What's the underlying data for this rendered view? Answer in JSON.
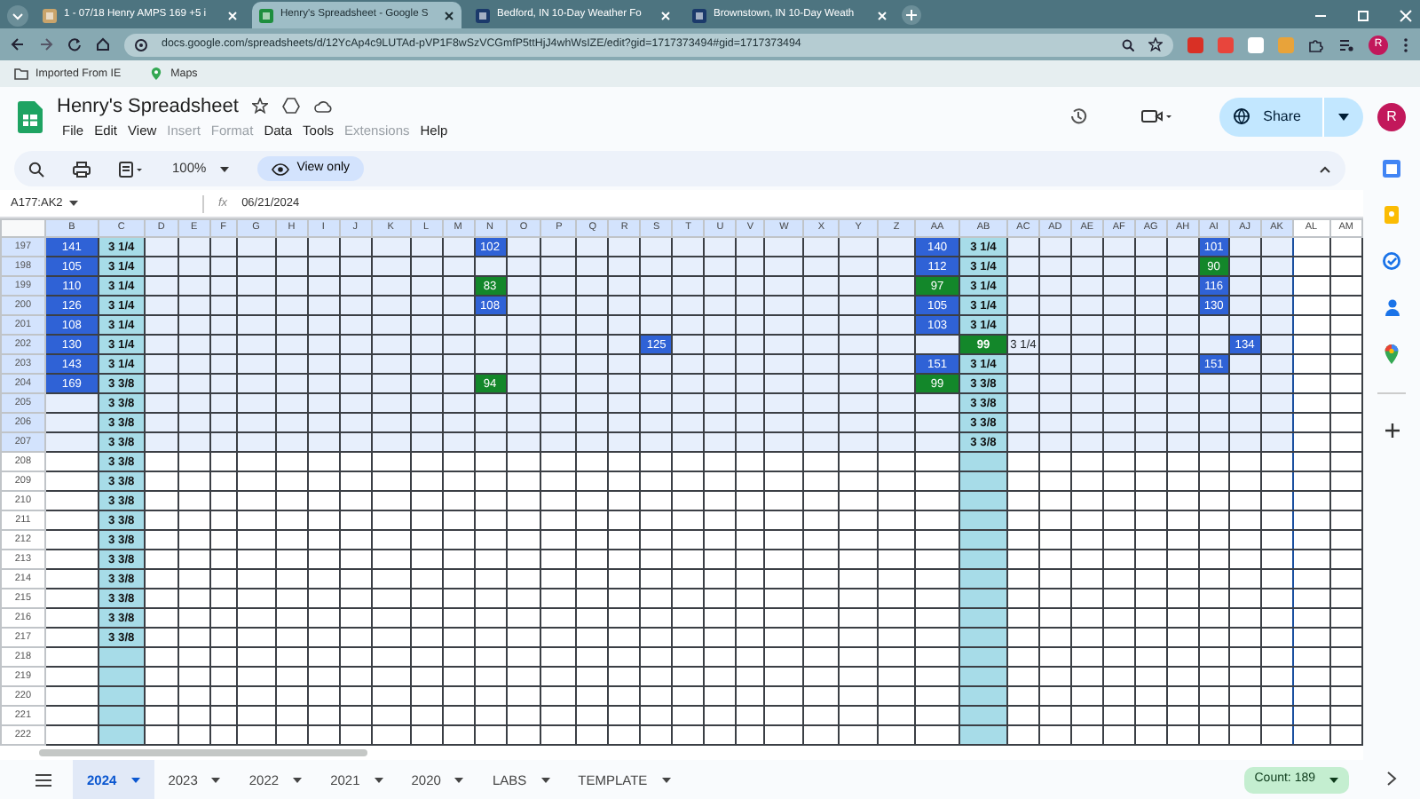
{
  "browser": {
    "tabs": [
      {
        "label": "1 - 07/18 Henry AMPS 169 +5 i",
        "selected": false
      },
      {
        "label": "Henry's Spreadsheet - Google S",
        "selected": true
      },
      {
        "label": "Bedford, IN 10-Day Weather Fo",
        "selected": false
      },
      {
        "label": "Brownstown, IN 10-Day Weath",
        "selected": false
      }
    ],
    "url": "docs.google.com/spreadsheets/d/12YcAp4c9LUTAd-pVP1F8wSzVCGmfP5ttHjJ4whWsIZE/edit?gid=1717373494#gid=1717373494",
    "bookmarks": [
      "Imported From IE",
      "Maps"
    ],
    "profile": "R"
  },
  "doc": {
    "title": "Henry's Spreadsheet",
    "menu": [
      {
        "label": "File",
        "disabled": false
      },
      {
        "label": "Edit",
        "disabled": false
      },
      {
        "label": "View",
        "disabled": false
      },
      {
        "label": "Insert",
        "disabled": true
      },
      {
        "label": "Format",
        "disabled": true
      },
      {
        "label": "Data",
        "disabled": false
      },
      {
        "label": "Tools",
        "disabled": false
      },
      {
        "label": "Extensions",
        "disabled": true
      },
      {
        "label": "Help",
        "disabled": false
      }
    ],
    "share": "Share",
    "avatar": "R"
  },
  "toolbar": {
    "zoom": "100%",
    "mode": "View only"
  },
  "formula_bar": {
    "name_box": "A177:AK2",
    "fx": "fx",
    "value": "06/21/2024"
  },
  "grid": {
    "columns": [
      {
        "label": "B",
        "selected": true,
        "shaded": false
      },
      {
        "label": "C",
        "selected": true,
        "shaded": true
      },
      {
        "label": "D",
        "selected": true,
        "shaded": false
      },
      {
        "label": "E",
        "selected": true,
        "shaded": false
      },
      {
        "label": "F",
        "selected": true,
        "shaded": false
      },
      {
        "label": "G",
        "selected": true,
        "shaded": false
      },
      {
        "label": "H",
        "selected": true,
        "shaded": false
      },
      {
        "label": "I",
        "selected": true,
        "shaded": false
      },
      {
        "label": "J",
        "selected": true,
        "shaded": false
      },
      {
        "label": "K",
        "selected": true,
        "shaded": false
      },
      {
        "label": "L",
        "selected": true,
        "shaded": false
      },
      {
        "label": "M",
        "selected": true,
        "shaded": false
      },
      {
        "label": "N",
        "selected": true,
        "shaded": false
      },
      {
        "label": "O",
        "selected": true,
        "shaded": false
      },
      {
        "label": "P",
        "selected": true,
        "shaded": false
      },
      {
        "label": "Q",
        "selected": true,
        "shaded": false
      },
      {
        "label": "R",
        "selected": true,
        "shaded": false
      },
      {
        "label": "S",
        "selected": true,
        "shaded": false
      },
      {
        "label": "T",
        "selected": true,
        "shaded": false
      },
      {
        "label": "U",
        "selected": true,
        "shaded": false
      },
      {
        "label": "V",
        "selected": true,
        "shaded": false
      },
      {
        "label": "W",
        "selected": true,
        "shaded": false
      },
      {
        "label": "X",
        "selected": true,
        "shaded": false
      },
      {
        "label": "Y",
        "selected": true,
        "shaded": false
      },
      {
        "label": "Z",
        "selected": true,
        "shaded": false
      },
      {
        "label": "AA",
        "selected": true,
        "shaded": false
      },
      {
        "label": "AB",
        "selected": true,
        "shaded": true
      },
      {
        "label": "AC",
        "selected": true,
        "shaded": false
      },
      {
        "label": "AD",
        "selected": true,
        "shaded": false
      },
      {
        "label": "AE",
        "selected": true,
        "shaded": false
      },
      {
        "label": "AF",
        "selected": true,
        "shaded": false
      },
      {
        "label": "AG",
        "selected": true,
        "shaded": false
      },
      {
        "label": "AH",
        "selected": true,
        "shaded": false
      },
      {
        "label": "AI",
        "selected": true,
        "shaded": false
      },
      {
        "label": "AJ",
        "selected": true,
        "shaded": false
      },
      {
        "label": "AK",
        "selected": true,
        "shaded": false
      },
      {
        "label": "AL",
        "selected": false,
        "shaded": false
      },
      {
        "label": "AM",
        "selected": false,
        "shaded": false
      }
    ],
    "rows": [
      {
        "label": "197",
        "selected": true,
        "cells": [
          {
            "text": "141",
            "color": "#2f62d6"
          },
          "3  1/4",
          "",
          "",
          "",
          "",
          "",
          "",
          "",
          "",
          "",
          "",
          {
            "text": "102",
            "color": "#2f62d6"
          },
          "",
          "",
          "",
          "",
          "",
          "",
          "",
          "",
          "",
          "",
          "",
          "",
          {
            "text": "140",
            "color": "#2f62d6"
          },
          "3  1/4",
          "",
          "",
          "",
          "",
          "",
          "",
          {
            "text": "101",
            "color": "#2f62d6"
          }
        ]
      },
      {
        "label": "198",
        "selected": true,
        "cells": [
          {
            "text": "105",
            "color": "#2f62d6"
          },
          "3  1/4",
          "",
          "",
          "",
          "",
          "",
          "",
          "",
          "",
          "",
          "",
          "",
          "",
          "",
          "",
          "",
          "",
          "",
          "",
          "",
          "",
          "",
          "",
          "",
          {
            "text": "112",
            "color": "#2f62d6"
          },
          "3  1/4",
          "",
          "",
          "",
          "",
          "",
          "",
          {
            "text": "90",
            "color": "#13872a"
          }
        ]
      },
      {
        "label": "199",
        "selected": true,
        "cells": [
          {
            "text": "110",
            "color": "#2f62d6"
          },
          "3  1/4",
          "",
          "",
          "",
          "",
          "",
          "",
          "",
          "",
          "",
          "",
          {
            "text": "83",
            "color": "#13872a"
          },
          "",
          "",
          "",
          "",
          "",
          "",
          "",
          "",
          "",
          "",
          "",
          "",
          {
            "text": "97",
            "color": "#13872a"
          },
          "3  1/4",
          "",
          "",
          "",
          "",
          "",
          "",
          {
            "text": "116",
            "color": "#2f62d6"
          }
        ]
      },
      {
        "label": "200",
        "selected": true,
        "cells": [
          {
            "text": "126",
            "color": "#2f62d6"
          },
          "3  1/4",
          "",
          "",
          "",
          "",
          "",
          "",
          "",
          "",
          "",
          "",
          {
            "text": "108",
            "color": "#2f62d6"
          },
          "",
          "",
          "",
          "",
          "",
          "",
          "",
          "",
          "",
          "",
          "",
          "",
          {
            "text": "105",
            "color": "#2f62d6"
          },
          "3  1/4",
          "",
          "",
          "",
          "",
          "",
          "",
          {
            "text": "130",
            "color": "#2f62d6"
          }
        ]
      },
      {
        "label": "201",
        "selected": true,
        "cells": [
          {
            "text": "108",
            "color": "#2f62d6"
          },
          "3  1/4",
          "",
          "",
          "",
          "",
          "",
          "",
          "",
          "",
          "",
          "",
          "",
          "",
          "",
          "",
          "",
          "",
          "",
          "",
          "",
          "",
          "",
          "",
          "",
          {
            "text": "103",
            "color": "#2f62d6"
          },
          "3  1/4"
        ]
      },
      {
        "label": "202",
        "selected": true,
        "cells": [
          {
            "text": "130",
            "color": "#2f62d6"
          },
          "3  1/4",
          "",
          "",
          "",
          "",
          "",
          "",
          "",
          "",
          "",
          "",
          "",
          "",
          "",
          "",
          "",
          {
            "text": "125",
            "color": "#2f62d6"
          },
          "",
          "",
          "",
          "",
          "",
          "",
          "",
          "",
          {
            "text": "99",
            "color": "#13872a"
          },
          "3  1/4",
          "",
          "",
          "",
          "",
          "",
          "",
          {
            "text": "134",
            "color": "#2f62d6"
          }
        ]
      },
      {
        "label": "203",
        "selected": true,
        "cells": [
          {
            "text": "143",
            "color": "#2f62d6"
          },
          "3  1/4",
          "",
          "",
          "",
          "",
          "",
          "",
          "",
          "",
          "",
          "",
          "",
          "",
          "",
          "",
          "",
          "",
          "",
          "",
          "",
          "",
          "",
          "",
          "",
          {
            "text": "151",
            "color": "#2f62d6"
          },
          "3  1/4",
          "",
          "",
          "",
          "",
          "",
          "",
          {
            "text": "151",
            "color": "#2f62d6"
          }
        ]
      },
      {
        "label": "204",
        "selected": true,
        "cells": [
          {
            "text": "169",
            "color": "#2f62d6"
          },
          "3  3/8",
          "",
          "",
          "",
          "",
          "",
          "",
          "",
          "",
          "",
          "",
          {
            "text": "94",
            "color": "#13872a"
          },
          "",
          "",
          "",
          "",
          "",
          "",
          "",
          "",
          "",
          "",
          "",
          "",
          {
            "text": "99",
            "color": "#13872a"
          },
          "3  3/8"
        ]
      },
      {
        "label": "205",
        "selected": true,
        "cells": [
          "",
          "3  3/8",
          "",
          "",
          "",
          "",
          "",
          "",
          "",
          "",
          "",
          "",
          "",
          "",
          "",
          "",
          "",
          "",
          "",
          "",
          "",
          "",
          "",
          "",
          "",
          "",
          "3  3/8"
        ]
      },
      {
        "label": "206",
        "selected": true,
        "cells": [
          "",
          "3  3/8",
          "",
          "",
          "",
          "",
          "",
          "",
          "",
          "",
          "",
          "",
          "",
          "",
          "",
          "",
          "",
          "",
          "",
          "",
          "",
          "",
          "",
          "",
          "",
          "",
          "3  3/8"
        ]
      },
      {
        "label": "207",
        "selected": true,
        "cells": [
          "",
          "3  3/8",
          "",
          "",
          "",
          "",
          "",
          "",
          "",
          "",
          "",
          "",
          "",
          "",
          "",
          "",
          "",
          "",
          "",
          "",
          "",
          "",
          "",
          "",
          "",
          "",
          "3  3/8"
        ]
      },
      {
        "label": "208",
        "selected": false,
        "cells": [
          "",
          "3  3/8"
        ]
      },
      {
        "label": "209",
        "selected": false,
        "cells": [
          "",
          "3  3/8"
        ]
      },
      {
        "label": "210",
        "selected": false,
        "cells": [
          "",
          "3  3/8"
        ]
      },
      {
        "label": "211",
        "selected": false,
        "cells": [
          "",
          "3  3/8"
        ]
      },
      {
        "label": "212",
        "selected": false,
        "cells": [
          "",
          "3  3/8"
        ]
      },
      {
        "label": "213",
        "selected": false,
        "cells": [
          "",
          "3  3/8"
        ]
      },
      {
        "label": "214",
        "selected": false,
        "cells": [
          "",
          "3  3/8"
        ]
      },
      {
        "label": "215",
        "selected": false,
        "cells": [
          "",
          "3  3/8"
        ]
      },
      {
        "label": "216",
        "selected": false,
        "cells": [
          "",
          "3  3/8"
        ]
      },
      {
        "label": "217",
        "selected": false,
        "cells": [
          "",
          "3  3/8"
        ]
      },
      {
        "label": "218",
        "selected": false,
        "cells": []
      },
      {
        "label": "219",
        "selected": false,
        "cells": []
      },
      {
        "label": "220",
        "selected": false,
        "cells": []
      },
      {
        "label": "221",
        "selected": false,
        "cells": []
      },
      {
        "label": "222",
        "selected": false,
        "cells": []
      }
    ]
  },
  "sheets": [
    {
      "label": "2024",
      "selected": true
    },
    {
      "label": "2023",
      "selected": false
    },
    {
      "label": "2022",
      "selected": false
    },
    {
      "label": "2021",
      "selected": false
    },
    {
      "label": "2020",
      "selected": false
    },
    {
      "label": "LABS",
      "selected": false
    },
    {
      "label": "TEMPLATE",
      "selected": false
    }
  ],
  "status": "Count: 189"
}
